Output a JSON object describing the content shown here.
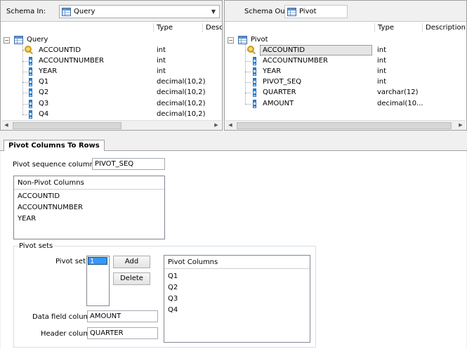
{
  "schema_in": {
    "label": "Schema In:",
    "selected": "Query",
    "col_type": "Type",
    "col_desc": "Desc",
    "root": "Query",
    "rows": [
      {
        "name": "ACCOUNTID",
        "type": "int",
        "icon": "key-icon"
      },
      {
        "name": "ACCOUNTNUMBER",
        "type": "int",
        "icon": "column-icon"
      },
      {
        "name": "YEAR",
        "type": "int",
        "icon": "column-icon"
      },
      {
        "name": "Q1",
        "type": "decimal(10,2)",
        "icon": "column-icon"
      },
      {
        "name": "Q2",
        "type": "decimal(10,2)",
        "icon": "column-icon"
      },
      {
        "name": "Q3",
        "type": "decimal(10,2)",
        "icon": "column-icon"
      },
      {
        "name": "Q4",
        "type": "decimal(10,2)",
        "icon": "column-icon"
      }
    ]
  },
  "schema_out": {
    "label": "Schema Out:",
    "selected": "Pivot",
    "col_type": "Type",
    "col_desc": "Description",
    "root": "Pivot",
    "rows": [
      {
        "name": "ACCOUNTID",
        "type": "int",
        "icon": "key-icon"
      },
      {
        "name": "ACCOUNTNUMBER",
        "type": "int",
        "icon": "column-icon"
      },
      {
        "name": "YEAR",
        "type": "int",
        "icon": "column-icon"
      },
      {
        "name": "PIVOT_SEQ",
        "type": "int",
        "icon": "column-icon"
      },
      {
        "name": "QUARTER",
        "type": "varchar(12)",
        "icon": "column-icon"
      },
      {
        "name": "AMOUNT",
        "type": "decimal(10...",
        "icon": "column-icon"
      }
    ]
  },
  "tab": {
    "label": "Pivot Columns To Rows"
  },
  "pivot_seq": {
    "label": "Pivot sequence column:",
    "value": "PIVOT_SEQ"
  },
  "non_pivot": {
    "header": "Non-Pivot Columns",
    "items": [
      "ACCOUNTID",
      "ACCOUNTNUMBER",
      "YEAR"
    ]
  },
  "pivot_sets": {
    "title": "Pivot sets",
    "set_label": "Pivot set:",
    "sets": [
      "1"
    ],
    "add": "Add",
    "delete": "Delete",
    "data_field_label": "Data field column:",
    "data_field_value": "AMOUNT",
    "header_label": "Header column:",
    "header_value": "QUARTER",
    "columns_header": "Pivot Columns",
    "columns": [
      "Q1",
      "Q2",
      "Q3",
      "Q4"
    ]
  }
}
